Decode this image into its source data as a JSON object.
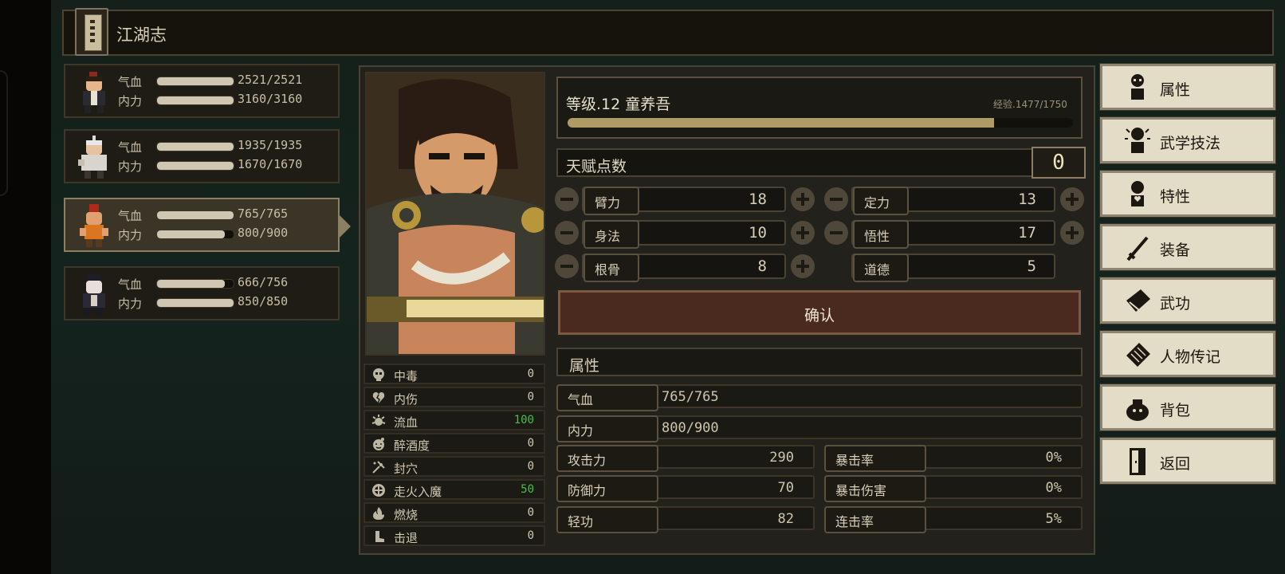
{
  "header": {
    "title": "江湖志"
  },
  "party": [
    {
      "hp_label": "气血",
      "hp": "2521/2521",
      "hp_frac": 1.0,
      "mp_label": "内力",
      "mp": "3160/3160",
      "mp_frac": 1.0
    },
    {
      "hp_label": "气血",
      "hp": "1935/1935",
      "hp_frac": 1.0,
      "mp_label": "内力",
      "mp": "1670/1670",
      "mp_frac": 1.0
    },
    {
      "hp_label": "气血",
      "hp": "765/765",
      "hp_frac": 1.0,
      "mp_label": "内力",
      "mp": "800/900",
      "mp_frac": 0.889
    },
    {
      "hp_label": "气血",
      "hp": "666/756",
      "hp_frac": 0.881,
      "mp_label": "内力",
      "mp": "850/850",
      "mp_frac": 1.0
    }
  ],
  "character": {
    "level_text": "等级.12  童养吾",
    "exp_text": "经验.1477/1750",
    "exp_frac": 0.844
  },
  "talent": {
    "label": "天赋点数",
    "points": "0"
  },
  "stats": [
    {
      "name": "臂力",
      "value": "18"
    },
    {
      "name": "定力",
      "value": "13"
    },
    {
      "name": "身法",
      "value": "10"
    },
    {
      "name": "悟性",
      "value": "17"
    },
    {
      "name": "根骨",
      "value": "8"
    },
    {
      "name": "道德",
      "value": "5"
    }
  ],
  "confirm_label": "确认",
  "attributes": {
    "heading": "属性",
    "hp_label": "气血",
    "hp": "765/765",
    "mp_label": "内力",
    "mp": "800/900",
    "grid": [
      {
        "name": "攻击力",
        "value": "290"
      },
      {
        "name": "暴击率",
        "value": "0%"
      },
      {
        "name": "防御力",
        "value": "70"
      },
      {
        "name": "暴击伤害",
        "value": "0%"
      },
      {
        "name": "轻功",
        "value": "82"
      },
      {
        "name": "连击率",
        "value": "5%"
      }
    ]
  },
  "status_effects": [
    {
      "name": "中毒",
      "value": "0",
      "icon": "skull-icon"
    },
    {
      "name": "内伤",
      "value": "0",
      "icon": "broken-heart-icon"
    },
    {
      "name": "流血",
      "value": "100",
      "icon": "blood-icon",
      "color": "#3fc43f"
    },
    {
      "name": "醉酒度",
      "value": "0",
      "icon": "drunk-icon"
    },
    {
      "name": "封穴",
      "value": "0",
      "icon": "acupoint-icon"
    },
    {
      "name": "走火入魔",
      "value": "50",
      "icon": "madness-icon",
      "color": "#3fc43f"
    },
    {
      "name": "燃烧",
      "value": "0",
      "icon": "fire-icon"
    },
    {
      "name": "击退",
      "value": "0",
      "icon": "boot-icon"
    }
  ],
  "menu": [
    {
      "label": "属性",
      "icon": "attribute-icon"
    },
    {
      "label": "武学技法",
      "icon": "martial-skill-icon"
    },
    {
      "label": "特性",
      "icon": "trait-icon"
    },
    {
      "label": "装备",
      "icon": "sword-icon"
    },
    {
      "label": "武功",
      "icon": "manual-icon"
    },
    {
      "label": "人物传记",
      "icon": "biography-icon"
    },
    {
      "label": "背包",
      "icon": "bag-icon"
    },
    {
      "label": "返回",
      "icon": "door-icon"
    }
  ]
}
